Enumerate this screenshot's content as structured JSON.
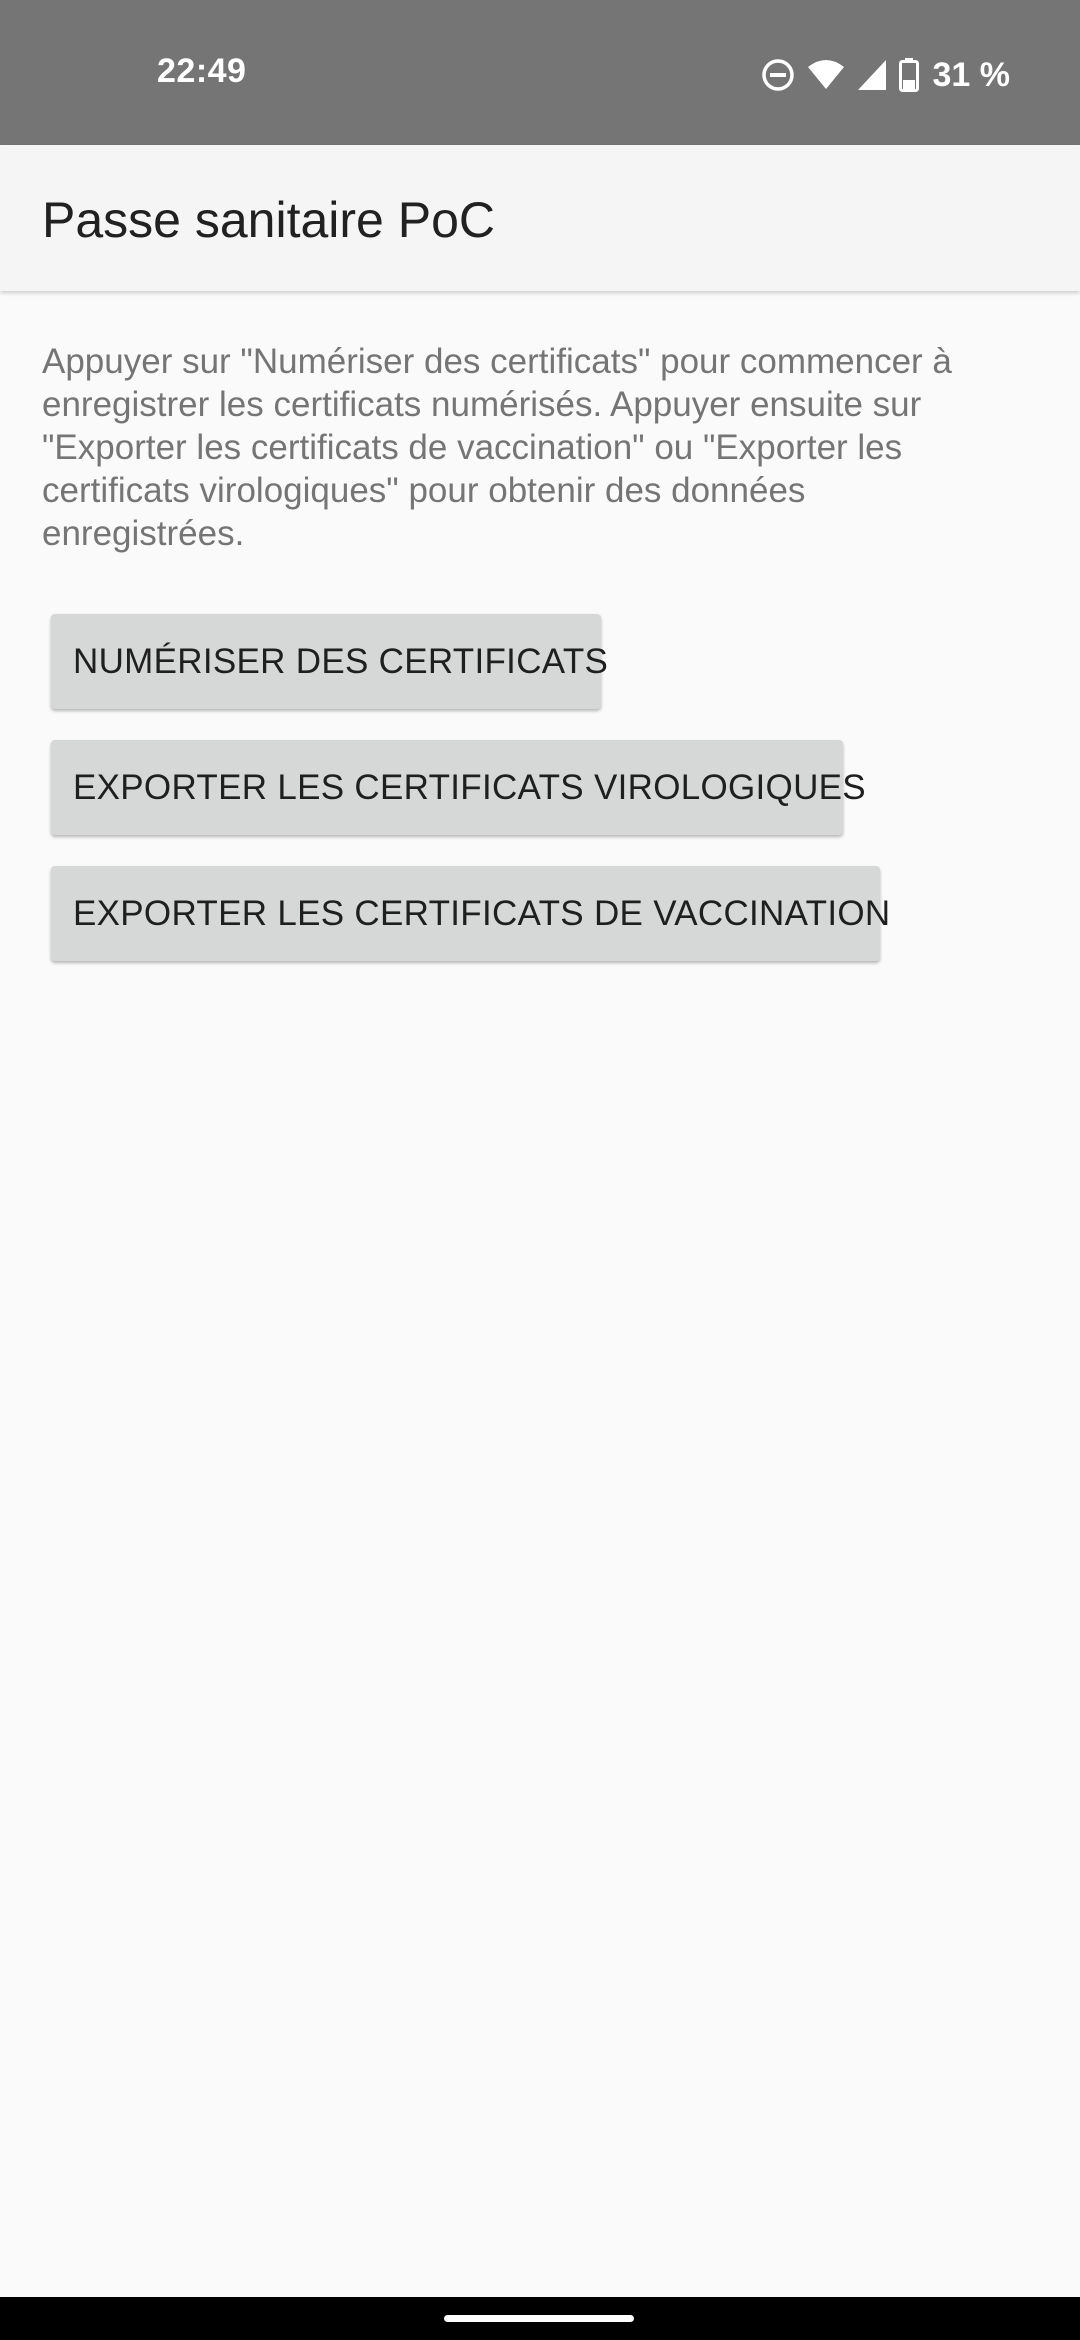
{
  "status_bar": {
    "time": "22:49",
    "battery": "31 %",
    "icons": [
      "do-not-disturb-icon",
      "wifi-icon",
      "cell-signal-icon",
      "battery-icon"
    ]
  },
  "app_bar": {
    "title": "Passe sanitaire PoC"
  },
  "main": {
    "description": "Appuyer sur \"Numériser des certificats\" pour commencer à enregistrer les certificats numérisés. Appuyer ensuite sur \"Exporter les certificats de vaccination\" ou \"Exporter les certificats virologiques\" pour obtenir des données enregistrées.",
    "buttons": {
      "scan_label": "NUMÉRISER DES CERTIFICATS",
      "export_viro_label": "EXPORTER LES CERTIFICATS VIROLOGIQUES",
      "export_vacc_label": "EXPORTER LES CERTIFICATS DE VACCINATION"
    }
  },
  "colors": {
    "status_bar_bg": "#757575",
    "app_bar_bg": "#f5f5f5",
    "page_bg": "#fafafa",
    "button_bg": "#d6d7d7",
    "description_text": "#757575",
    "title_text": "#212121"
  }
}
